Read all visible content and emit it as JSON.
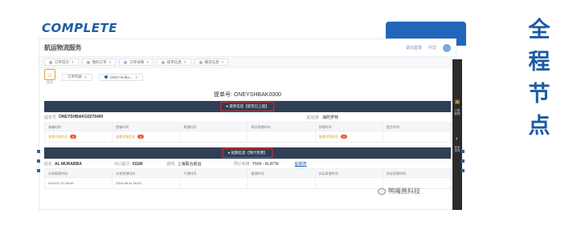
{
  "heading": {
    "complete": "COMPLETE"
  },
  "side_title": [
    "全",
    "程",
    "节",
    "点"
  ],
  "app": {
    "logo": "航运物流服务",
    "topbar_link": "退出登录",
    "topbar_lang": "中文",
    "tabs": [
      {
        "label": "订单首页"
      },
      {
        "label": "我的订单"
      },
      {
        "label": "订单详情"
      },
      {
        "label": "提单信息"
      },
      {
        "label": "箱货信息"
      }
    ],
    "home_label": "首页",
    "subtabs": [
      {
        "label": "订单列表"
      },
      {
        "label": "ONEYSHBA...",
        "active": true
      }
    ],
    "bl_title": "提单号: ONEYSHBAK0000",
    "section1": {
      "label": "● 提单信息【提货已上船】",
      "info": {
        "bl_key": "提单号",
        "bl_value": "ONEYSHBAKG0276400",
        "pol_key": "起运港",
        "pol_value": "海防罗特"
      },
      "headers": [
        "装箱时间",
        "提箱时间",
        "离港时间",
        "预计到港时间",
        "到港时间",
        "提货时间"
      ],
      "row": [
        {
          "text": "查看详细信息",
          "badge": "0"
        },
        {
          "text": "查看详细信息",
          "badge": "0"
        },
        {
          "text": ""
        },
        {
          "text": ""
        },
        {
          "text": "查看详细信息",
          "badge": "0"
        },
        {
          "text": ""
        }
      ]
    },
    "section2": {
      "label": "● 船期信息【预计到港】",
      "info": {
        "vessel_key": "船名",
        "vessel_value": "AL MURABBA",
        "voyage_key": "出口航次",
        "voyage_value": "011W",
        "route_key": "航线",
        "route_value": "上海联合航运",
        "eta_key": "预计到港",
        "eta_value": "Y504 - KLRTM",
        "link": "船期表"
      },
      "headers": [
        "计划离港时间",
        "计划到港时间",
        "开港时间",
        "截港时间",
        "实际离港时间",
        "实际到港时间"
      ],
      "row": [
        "2019-07-31 00:00",
        "2019-08-31 00:00",
        "",
        "",
        "",
        ""
      ]
    }
  },
  "right_strip": [
    "订单管理",
    "信息查询"
  ],
  "watermark": "鸭嘴兽科技"
}
